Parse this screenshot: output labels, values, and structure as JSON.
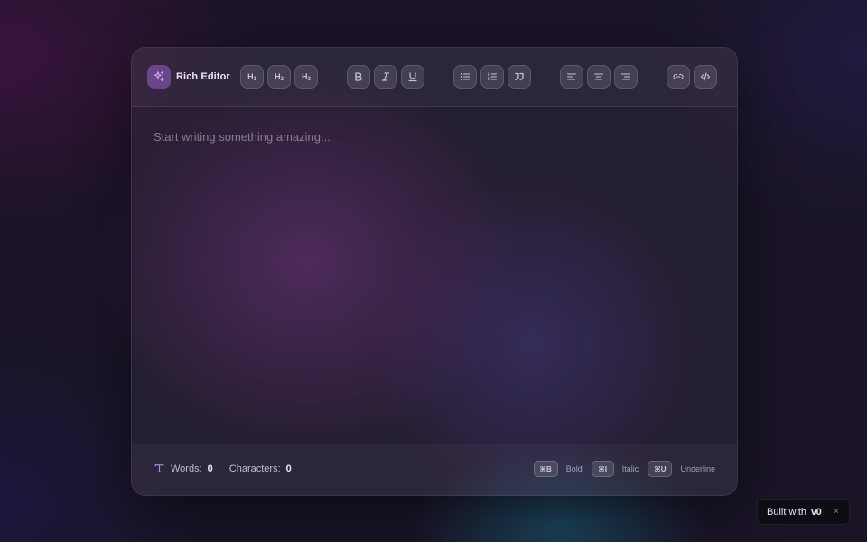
{
  "toolbar": {
    "title": "Rich Editor",
    "headings": [
      {
        "letter": "H",
        "level": "1"
      },
      {
        "letter": "H",
        "level": "2"
      },
      {
        "letter": "H",
        "level": "3"
      }
    ]
  },
  "editor": {
    "placeholder": "Start writing something amazing..."
  },
  "footer": {
    "words_label": "Words:",
    "words_count": "0",
    "chars_label": "Characters:",
    "chars_count": "0",
    "shortcuts": [
      {
        "key": "⌘B",
        "label": "Bold"
      },
      {
        "key": "⌘I",
        "label": "Italic"
      },
      {
        "key": "⌘U",
        "label": "Underline"
      }
    ]
  },
  "badge": {
    "text": "Built with",
    "logo": "v0",
    "close": "×"
  },
  "colors": {
    "accent": "#9a6fd0",
    "background": "#1a1426",
    "text": "#ece6f2"
  },
  "icons": {
    "brand": "sparkles-icon",
    "bold": "bold-icon",
    "italic": "italic-icon",
    "underline": "underline-icon",
    "bullet_list": "bullet-list-icon",
    "ordered_list": "ordered-list-icon",
    "quote": "quote-icon",
    "align_left": "align-left-icon",
    "align_center": "align-center-icon",
    "align_right": "align-right-icon",
    "link": "link-icon",
    "code": "code-icon",
    "text_type": "text-type-icon"
  }
}
